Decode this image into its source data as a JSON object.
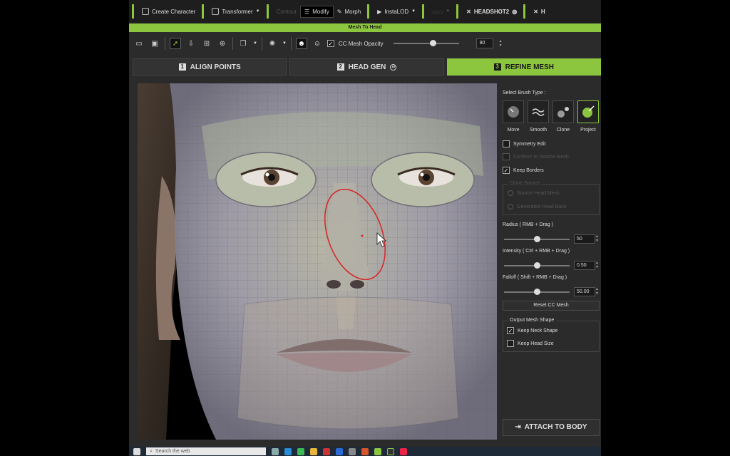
{
  "toolbar": {
    "items": [
      {
        "label": "Create Character",
        "icon": "grid-icon",
        "enabled": true
      },
      {
        "label": "Transformer",
        "icon": "transform-icon",
        "enabled": true
      },
      {
        "label": "Contour",
        "icon": "contour-icon",
        "enabled": false
      },
      {
        "label": "Modify",
        "icon": "sliders-icon",
        "enabled": true,
        "active": true
      },
      {
        "label": "Morph",
        "icon": "morph-icon",
        "enabled": true
      },
      {
        "label": "InstaLOD",
        "icon": "play-icon",
        "enabled": true
      },
      {
        "label": "HEADSHOT2",
        "icon": "headshot-icon",
        "enabled": true
      },
      {
        "label": "H",
        "icon": "headshot-icon",
        "enabled": true
      }
    ]
  },
  "window_title": "Mesh To Head",
  "tool_row": {
    "opacity_label": "CC Mesh Opacity",
    "opacity_value": "80",
    "opacity_fraction": 0.6
  },
  "tabs": [
    {
      "num": "1",
      "label": "ALIGN POINTS",
      "active": false
    },
    {
      "num": "2",
      "label": "HEAD GEN",
      "active": false
    },
    {
      "num": "3",
      "label": "REFINE MESH",
      "active": true
    }
  ],
  "panel": {
    "brush_type_label": "Select Brush Type :",
    "brushes": [
      {
        "label": "Move",
        "icon": "move-brush-icon",
        "selected": false
      },
      {
        "label": "Smooth",
        "icon": "smooth-brush-icon",
        "selected": false
      },
      {
        "label": "Clone",
        "icon": "clone-brush-icon",
        "selected": false
      },
      {
        "label": "Project",
        "icon": "project-brush-icon",
        "selected": true
      }
    ],
    "symmetry_edit": "Symmetry Edit",
    "conform_label": "Conform to Source Mesh",
    "keep_borders": "Keep Borders",
    "clone_source_title": "Clone Source",
    "clone_source_opt1": "Source Head Mesh",
    "clone_source_opt2": "Generated Head Base",
    "radius_label": "Radius ( RMB + Drag )",
    "radius_value": "50",
    "radius_fraction": 0.5,
    "intensity_label": "Intensity ( Ctrl + RMB + Drag )",
    "intensity_value": "0.50",
    "intensity_fraction": 0.5,
    "falloff_label": "Falloff ( Shift + RMB + Drag )",
    "falloff_value": "50.00",
    "falloff_fraction": 0.5,
    "reset_button": "Reset CC Mesh",
    "output_title": "Output Mesh Shape",
    "keep_neck": "Keep Neck Shape",
    "keep_neck_checked": true,
    "keep_head": "Keep Head Size",
    "keep_head_checked": false,
    "attach_button": "ATTACH TO BODY"
  },
  "taskbar": {
    "search_placeholder": "Search the web"
  },
  "colors": {
    "accent": "#8cc63f",
    "panel_bg": "#2b2b2b",
    "brush_ring": "#d42a2a"
  }
}
